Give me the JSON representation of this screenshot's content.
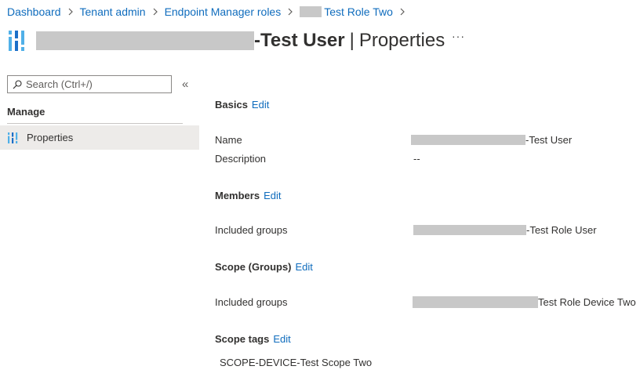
{
  "breadcrumb": {
    "items": [
      "Dashboard",
      "Tenant admin",
      "Endpoint Manager roles"
    ],
    "current_suffix": "Test Role Two"
  },
  "header": {
    "title_suffix": "-Test User",
    "separator": "|",
    "page": "Properties",
    "more_label": "···"
  },
  "nav": {
    "search_placeholder": "Search (Ctrl+/)",
    "collapse_label": "«",
    "section_heading": "Manage",
    "items": [
      {
        "label": "Properties",
        "icon": "properties-icon",
        "selected": true
      }
    ]
  },
  "properties": {
    "edit_label": "Edit",
    "basics": {
      "title": "Basics",
      "name_label": "Name",
      "name_value_suffix": "-Test User",
      "description_label": "Description",
      "description_value": "--"
    },
    "members": {
      "title": "Members",
      "included_groups_label": "Included groups",
      "included_groups_value_suffix": "-Test Role User"
    },
    "scope_groups": {
      "title": "Scope (Groups)",
      "included_groups_label": "Included groups",
      "included_groups_value_suffix": "Test Role Device Two"
    },
    "scope_tags": {
      "title": "Scope tags",
      "value": "SCOPE-DEVICE-Test Scope Two"
    }
  },
  "colors": {
    "link": "#0f6cbd",
    "text": "#323130",
    "selected_bg": "#edebe9",
    "redaction": "#c8c8c8"
  }
}
